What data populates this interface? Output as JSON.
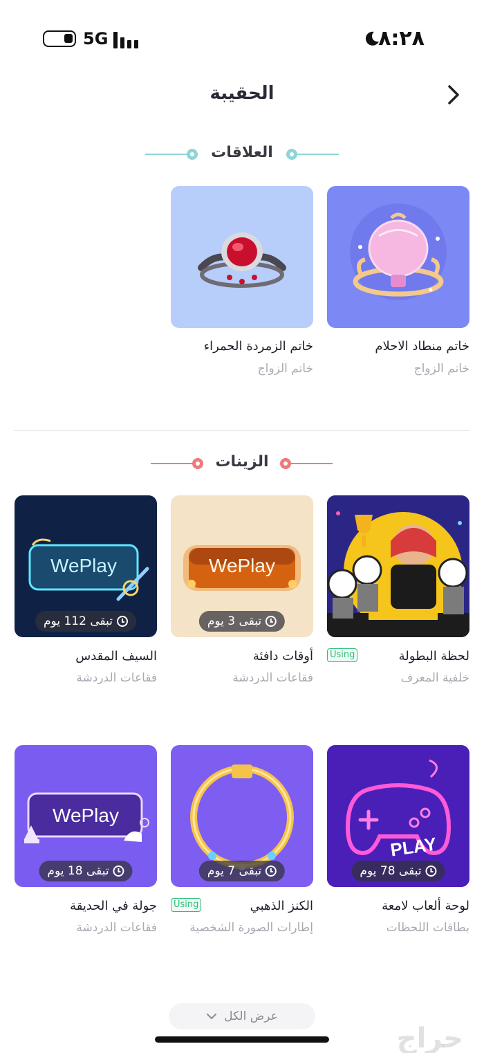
{
  "status_bar": {
    "time": "٨:٢٨",
    "network": "5G"
  },
  "header": {
    "title": "الحقيبة"
  },
  "sections": {
    "relations": {
      "title": "العلاقات",
      "accent": "#8fd6d6"
    },
    "decorations": {
      "title": "الزينات",
      "accent": "#ee7a7a"
    }
  },
  "relations_items": [
    {
      "name": "خاتم منطاد الاحلام",
      "type": "خاتم الزواج",
      "bg": "#7c88f4"
    },
    {
      "name": "خاتم الزمردة الحمراء",
      "type": "خاتم الزواج",
      "bg": "#b7cdfa"
    }
  ],
  "decoration_items": [
    {
      "name": "لحظة البطولة",
      "type": "خلفية المعرف",
      "using": "Using",
      "bg": "#3c2fa4"
    },
    {
      "name": "أوقات دافئة",
      "type": "فقاعات الدردشة",
      "remaining": "تبقى 3 يوم",
      "card_text": "WePlay",
      "bg": "#f4e3c6"
    },
    {
      "name": "السيف المقدس",
      "type": "فقاعات الدردشة",
      "remaining": "تبقى 112 يوم",
      "card_text": "WePlay",
      "bg": "#0f2246"
    },
    {
      "name": "لوحة ألعاب لامعة",
      "type": "بطاقات اللحظات",
      "remaining": "تبقى 78 يوم",
      "card_text": "PLAY",
      "bg": "#5a2bd0"
    },
    {
      "name": "الكنز الذهبي",
      "type": "إطارات الصورة الشخصية",
      "using": "Using",
      "remaining": "تبقى 7 يوم",
      "bg": "#7d5ef0"
    },
    {
      "name": "جولة في الحديقة",
      "type": "فقاعات الدردشة",
      "remaining": "تبقى 18 يوم",
      "card_text": "WePlay",
      "bg": "#7a5cf0"
    }
  ],
  "footer": {
    "view_all": "عرض الكل",
    "watermark": "حراج"
  }
}
